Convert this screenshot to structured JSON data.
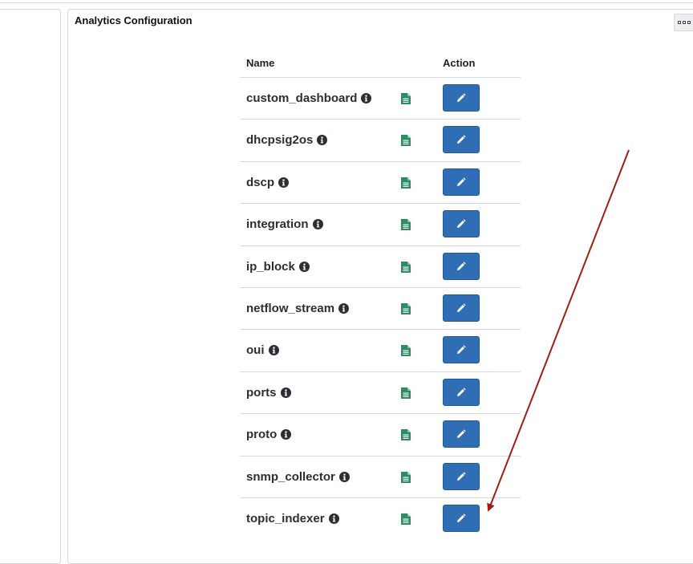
{
  "panel": {
    "title": "Analytics Configuration",
    "menu_icon": "more-icon"
  },
  "table": {
    "headers": {
      "name": "Name",
      "action": "Action"
    },
    "rows": [
      {
        "name": "custom_dashboard"
      },
      {
        "name": "dhcpsig2os"
      },
      {
        "name": "dscp"
      },
      {
        "name": "integration"
      },
      {
        "name": "ip_block"
      },
      {
        "name": "netflow_stream"
      },
      {
        "name": "oui"
      },
      {
        "name": "ports"
      },
      {
        "name": "proto"
      },
      {
        "name": "snmp_collector"
      },
      {
        "name": "topic_indexer"
      }
    ]
  },
  "icons": {
    "info": "info-circle-icon",
    "document": "document-icon",
    "edit": "pencil-icon"
  },
  "annotation": {
    "shape": "arrow",
    "color": "#a01e14",
    "points_to": "topic_indexer edit button"
  },
  "colors": {
    "button": "#2f6db5",
    "document_icon": "#2e8b64",
    "border": "#d6dae0"
  }
}
